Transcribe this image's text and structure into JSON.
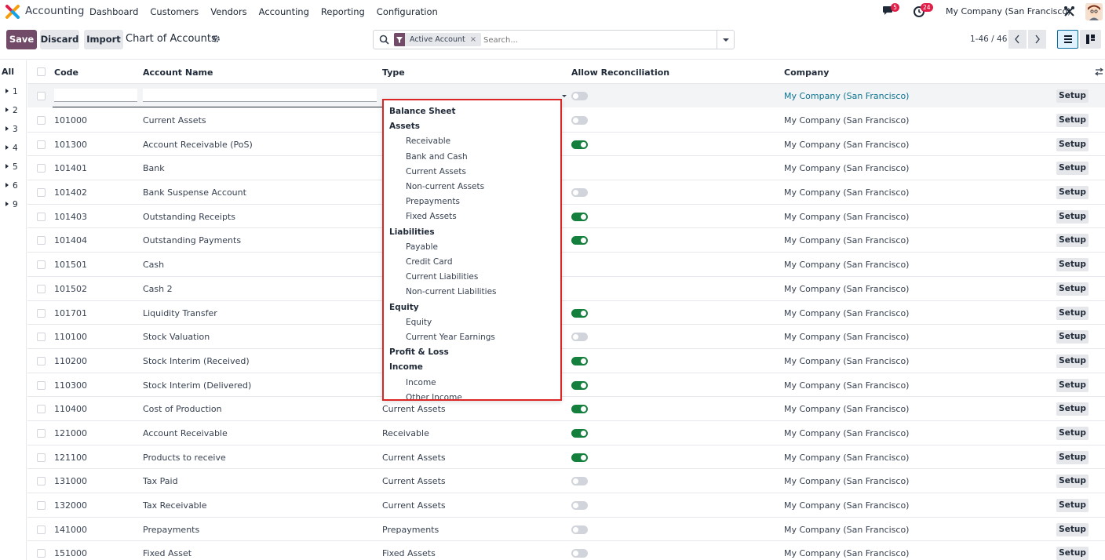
{
  "navbar": {
    "app_name": "Accounting",
    "menu": [
      "Dashboard",
      "Customers",
      "Vendors",
      "Accounting",
      "Reporting",
      "Configuration"
    ],
    "chat_count": "5",
    "activity_count": "24",
    "company": "My Company (San Francisco)"
  },
  "control": {
    "save_label": "Save",
    "discard_label": "Discard",
    "import_label": "Import",
    "title": "Chart of Accounts",
    "facet_label": "Active Account",
    "search_placeholder": "Search...",
    "pager": "1-46 / 46"
  },
  "groups": {
    "all_label": "All",
    "items": [
      "1",
      "2",
      "3",
      "4",
      "5",
      "6",
      "9"
    ]
  },
  "table": {
    "headers": {
      "code": "Code",
      "name": "Account Name",
      "type": "Type",
      "reconcile": "Allow Reconciliation",
      "company": "Company"
    },
    "edit_row": {
      "company": "My Company (San Francisco)",
      "setup": "Setup"
    },
    "rows": [
      {
        "code": "101000",
        "name": "Current Assets",
        "type": "",
        "toggle": "off",
        "company": "My Company (San Francisco)"
      },
      {
        "code": "101300",
        "name": "Account Receivable (PoS)",
        "type": "",
        "toggle": "on",
        "company": "My Company (San Francisco)"
      },
      {
        "code": "101401",
        "name": "Bank",
        "type": "",
        "toggle": "none",
        "company": "My Company (San Francisco)"
      },
      {
        "code": "101402",
        "name": "Bank Suspense Account",
        "type": "",
        "toggle": "off",
        "company": "My Company (San Francisco)"
      },
      {
        "code": "101403",
        "name": "Outstanding Receipts",
        "type": "",
        "toggle": "on",
        "company": "My Company (San Francisco)"
      },
      {
        "code": "101404",
        "name": "Outstanding Payments",
        "type": "",
        "toggle": "on",
        "company": "My Company (San Francisco)"
      },
      {
        "code": "101501",
        "name": "Cash",
        "type": "",
        "toggle": "none",
        "company": "My Company (San Francisco)"
      },
      {
        "code": "101502",
        "name": "Cash 2",
        "type": "",
        "toggle": "none",
        "company": "My Company (San Francisco)"
      },
      {
        "code": "101701",
        "name": "Liquidity Transfer",
        "type": "",
        "toggle": "on",
        "company": "My Company (San Francisco)"
      },
      {
        "code": "110100",
        "name": "Stock Valuation",
        "type": "",
        "toggle": "off",
        "company": "My Company (San Francisco)"
      },
      {
        "code": "110200",
        "name": "Stock Interim (Received)",
        "type": "",
        "toggle": "on",
        "company": "My Company (San Francisco)"
      },
      {
        "code": "110300",
        "name": "Stock Interim (Delivered)",
        "type": "",
        "toggle": "on",
        "company": "My Company (San Francisco)"
      },
      {
        "code": "110400",
        "name": "Cost of Production",
        "type": "Current Assets",
        "toggle": "on",
        "company": "My Company (San Francisco)"
      },
      {
        "code": "121000",
        "name": "Account Receivable",
        "type": "Receivable",
        "toggle": "on",
        "company": "My Company (San Francisco)"
      },
      {
        "code": "121100",
        "name": "Products to receive",
        "type": "Current Assets",
        "toggle": "on",
        "company": "My Company (San Francisco)"
      },
      {
        "code": "131000",
        "name": "Tax Paid",
        "type": "Current Assets",
        "toggle": "off",
        "company": "My Company (San Francisco)"
      },
      {
        "code": "132000",
        "name": "Tax Receivable",
        "type": "Current Assets",
        "toggle": "off",
        "company": "My Company (San Francisco)"
      },
      {
        "code": "141000",
        "name": "Prepayments",
        "type": "Prepayments",
        "toggle": "off",
        "company": "My Company (San Francisco)"
      },
      {
        "code": "151000",
        "name": "Fixed Asset",
        "type": "Fixed Assets",
        "toggle": "off",
        "company": "My Company (San Francisco)"
      }
    ],
    "setup_label": "Setup"
  },
  "dropdown": {
    "items": [
      {
        "label": "Balance Sheet",
        "kind": "group"
      },
      {
        "label": "Assets",
        "kind": "group"
      },
      {
        "label": "Receivable",
        "kind": "child"
      },
      {
        "label": "Bank and Cash",
        "kind": "child"
      },
      {
        "label": "Current Assets",
        "kind": "child"
      },
      {
        "label": "Non-current Assets",
        "kind": "child"
      },
      {
        "label": "Prepayments",
        "kind": "child"
      },
      {
        "label": "Fixed Assets",
        "kind": "child"
      },
      {
        "label": "Liabilities",
        "kind": "group"
      },
      {
        "label": "Payable",
        "kind": "child"
      },
      {
        "label": "Credit Card",
        "kind": "child"
      },
      {
        "label": "Current Liabilities",
        "kind": "child"
      },
      {
        "label": "Non-current Liabilities",
        "kind": "child"
      },
      {
        "label": "Equity",
        "kind": "group"
      },
      {
        "label": "Equity",
        "kind": "child"
      },
      {
        "label": "Current Year Earnings",
        "kind": "child"
      },
      {
        "label": "Profit & Loss",
        "kind": "group"
      },
      {
        "label": "Income",
        "kind": "group"
      },
      {
        "label": "Income",
        "kind": "child"
      },
      {
        "label": "Other Income",
        "kind": "child"
      }
    ]
  },
  "colors": {
    "brand": "#714b67",
    "toggle_on": "#15803d",
    "highlight_border": "#dc2626",
    "link": "#0e7490"
  }
}
